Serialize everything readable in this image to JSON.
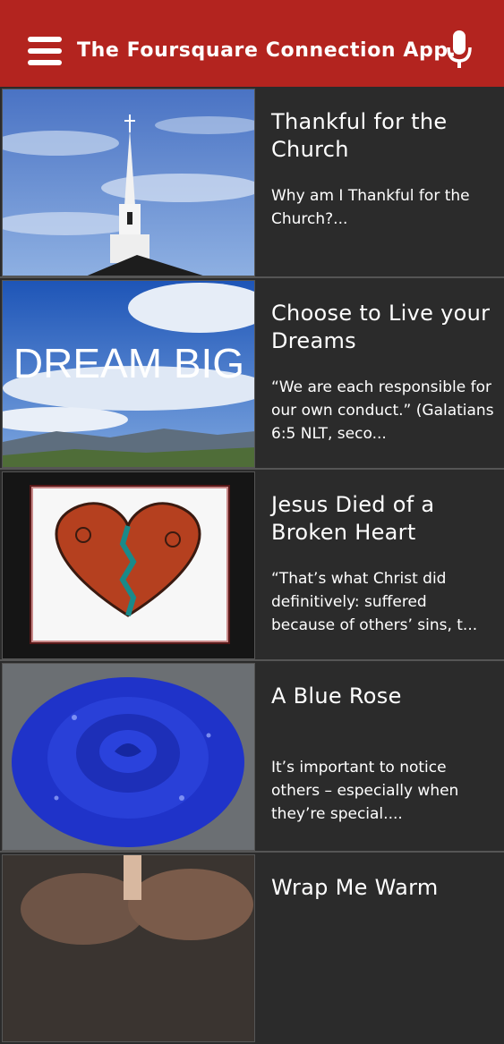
{
  "header": {
    "title": "The Foursquare Connection App.",
    "background": "#b3241f",
    "menu_icon": "hamburger-menu-icon",
    "mic_icon": "microphone-icon"
  },
  "articles": [
    {
      "title": "Thankful for the Church",
      "excerpt": "Why am I Thankful for the Church?...",
      "image": "church-steeple-image"
    },
    {
      "title": "Choose to Live your Dreams",
      "excerpt": "“We are each responsible for our own conduct.” (Galatians 6:5 NLT, seco...",
      "image": "dream-big-image",
      "image_text": "DREAM BIG"
    },
    {
      "title": "Jesus Died of a Broken Heart",
      "excerpt": "“That’s what Christ did definitively: suffered because of others’ sins, t...",
      "image": "broken-heart-image"
    },
    {
      "title": "A Blue Rose",
      "excerpt": "It’s important to notice others – especially when they’re special....",
      "image": "blue-rose-image"
    },
    {
      "title": "Wrap Me Warm",
      "excerpt": "",
      "image": "people-image"
    }
  ]
}
